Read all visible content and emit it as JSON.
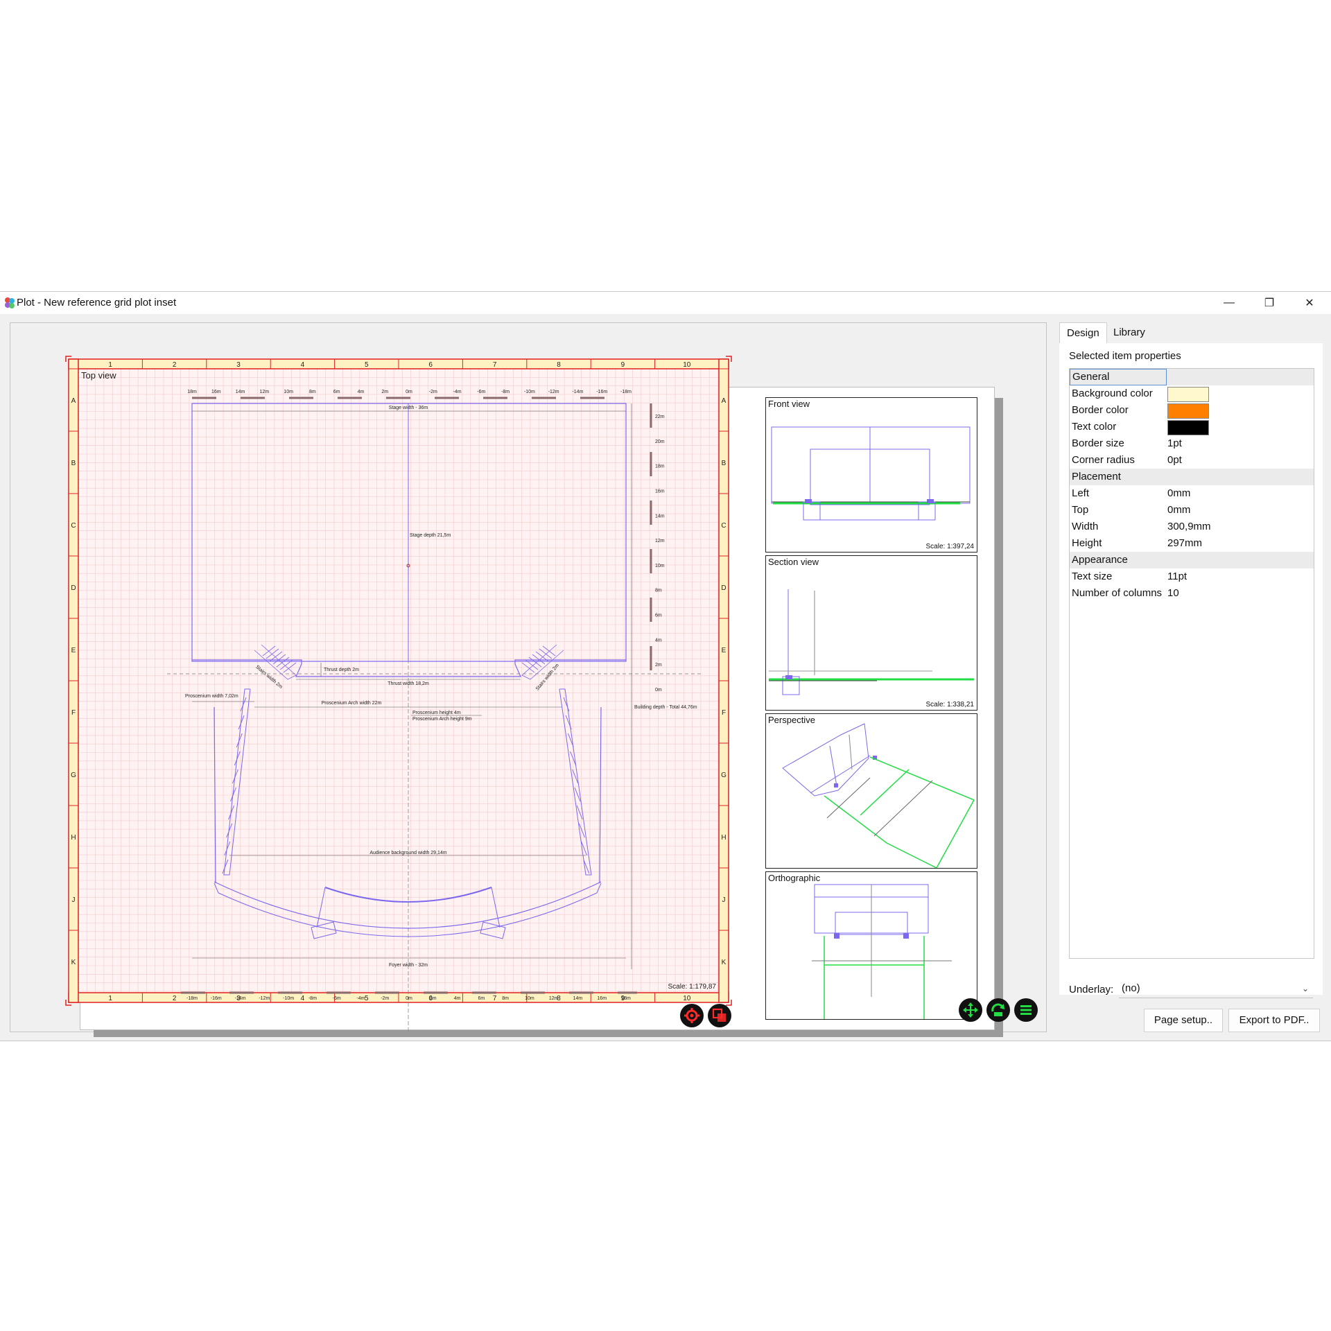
{
  "window": {
    "title": "Plot - New reference grid plot inset",
    "minimize_glyph": "—",
    "restore_glyph": "❐",
    "close_glyph": "✕"
  },
  "plot": {
    "columns": [
      "1",
      "2",
      "3",
      "4",
      "5",
      "6",
      "7",
      "8",
      "9",
      "10"
    ],
    "rows": [
      "A",
      "B",
      "C",
      "D",
      "E",
      "F",
      "G",
      "H",
      "J",
      "K"
    ],
    "top_view": {
      "label": "Top view",
      "scale": "Scale: 1:179,87",
      "ruler_top": [
        "18m",
        "16m",
        "14m",
        "12m",
        "10m",
        "8m",
        "6m",
        "4m",
        "2m",
        "0m",
        "-2m",
        "-4m",
        "-6m",
        "-8m",
        "-10m",
        "-12m",
        "-14m",
        "-16m",
        "-18m"
      ],
      "ruler_bottom": [
        "-18m",
        "-16m",
        "-14m",
        "-12m",
        "-10m",
        "-8m",
        "-6m",
        "-4m",
        "-2m",
        "0m",
        "2m",
        "4m",
        "6m",
        "8m",
        "10m",
        "12m",
        "14m",
        "16m",
        "18m"
      ],
      "ruler_right": [
        "22m",
        "20m",
        "18m",
        "16m",
        "14m",
        "12m",
        "10m",
        "8m",
        "6m",
        "4m",
        "2m",
        "0m"
      ],
      "annotations": {
        "stage_width": "Stage width - 36m",
        "stage_depth": "Stage depth  21,5m",
        "thrust_depth": "Thrust depth 2m",
        "thrust_width": "Thrust width 18,2m",
        "stairs_left": "Stairs width 2m",
        "stairs_right": "Stairs width 2m",
        "proscenium_width": "Proscenium width 7,02m",
        "proscenium_arch_width": "Proscenium Arch width 22m",
        "proscenium_height": "Proscenium height 4m",
        "proscenium_arch_height": "Proscenium Arch height 9m",
        "building_depth": "Building depth - Total 44,76m",
        "audience_width": "Audience background width 29,14m",
        "foyer_width": "Foyer width - 32m"
      }
    },
    "insets": [
      {
        "label": "Front view",
        "scale": "Scale: 1:397,24"
      },
      {
        "label": "Section view",
        "scale": "Scale: 1:338,21"
      },
      {
        "label": "Perspective",
        "scale": ""
      },
      {
        "label": "Orthographic",
        "scale": ""
      }
    ]
  },
  "colors": {
    "grid_frame": "#fff2c2",
    "frame_border": "#e02020",
    "plan_stroke": "#7b68ee",
    "green": "#22dd44"
  },
  "panel": {
    "tabs": {
      "design": "Design",
      "library": "Library"
    },
    "title": "Selected item properties",
    "groups": {
      "general": "General",
      "placement": "Placement",
      "appearance": "Appearance"
    },
    "general": {
      "background_color": {
        "label": "Background color",
        "color": "#fff8cc"
      },
      "border_color": {
        "label": "Border color",
        "color": "#ff7f00"
      },
      "text_color": {
        "label": "Text color",
        "color": "#000000"
      },
      "border_size": {
        "label": "Border size",
        "value": "1pt"
      },
      "corner_radius": {
        "label": "Corner radius",
        "value": "0pt"
      }
    },
    "placement": {
      "left": {
        "label": "Left",
        "value": "0mm"
      },
      "top": {
        "label": "Top",
        "value": "0mm"
      },
      "width": {
        "label": "Width",
        "value": "300,9mm"
      },
      "height": {
        "label": "Height",
        "value": "297mm"
      }
    },
    "appearance": {
      "text_size": {
        "label": "Text size",
        "value": "11pt"
      },
      "columns": {
        "label": "Number of columns",
        "value": "10"
      }
    },
    "underlay": {
      "label": "Underlay:",
      "value": "(no)"
    },
    "buttons": {
      "page_setup": "Page setup..",
      "export_pdf": "Export to PDF.."
    }
  }
}
